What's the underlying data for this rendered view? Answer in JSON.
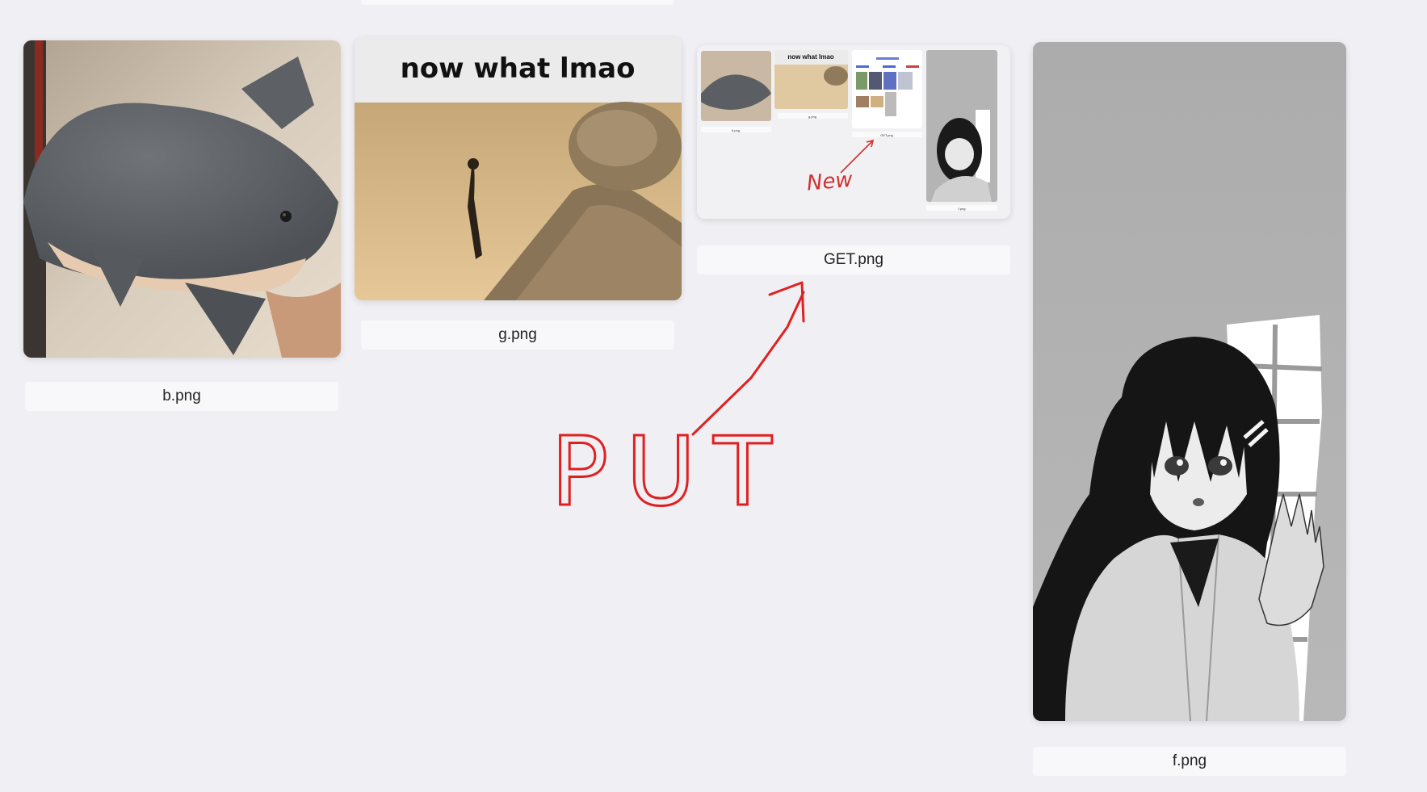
{
  "gallery": {
    "items": [
      {
        "filename": "b.png"
      },
      {
        "filename": "g.png",
        "caption_text": "now what lmao"
      },
      {
        "filename": "GET.png",
        "thumbnail": {
          "labels": [
            "b.png",
            "g.png",
            "GET.png",
            "f.png"
          ],
          "caption_text": "now what lmao",
          "annotation": "New"
        }
      },
      {
        "filename": "f.png"
      }
    ]
  },
  "annotation": {
    "text": "PUT",
    "color": "#e02020"
  }
}
